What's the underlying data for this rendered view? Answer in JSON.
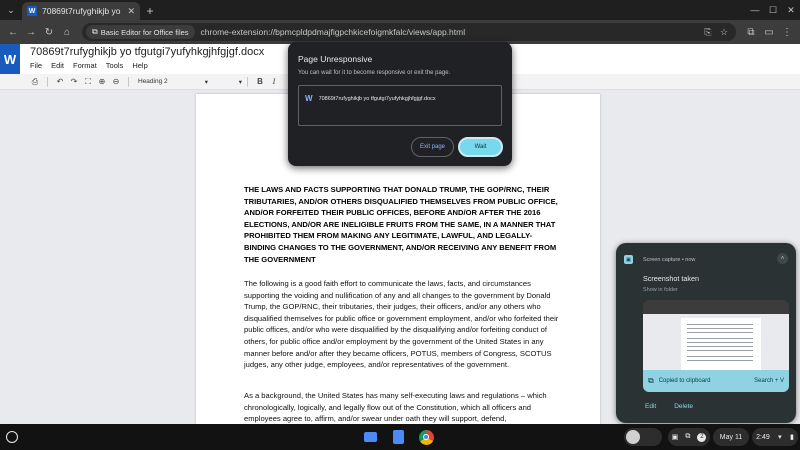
{
  "browser": {
    "tab_title": "70869t7rufyghikjb yo tfgutgi7yufyhkgjhfgjgf.docx",
    "tab_favicon": "W",
    "extension_chip": "Basic Editor for Office files",
    "url": "chrome-extension://bpmcpldpdmajfigpchkicefoigmkfalc/views/app.html"
  },
  "app": {
    "logo": "W",
    "doc_title": "70869t7rufyghikjb yo tfgutgi7yufyhkgjhfgjgf.docx",
    "menu": [
      "File",
      "Edit",
      "Format",
      "Tools",
      "Help"
    ],
    "style_select": "Heading 2",
    "bold": "B",
    "italic": "I"
  },
  "document": {
    "heading": "THE LAWS AND FACTS SUPPORTING THAT DONALD TRUMP, THE GOP/RNC, THEIR TRIBUTARIES, AND/OR OTHERS DISQUALIFIED THEMSELVES FROM PUBLIC OFFICE, AND/OR FORFEITED THEIR PUBLIC OFFICES, BEFORE AND/OR AFTER THE 2016 ELECTIONS, AND/OR ARE INELIGIBLE FRUITS FROM THE SAME, IN A MANNER THAT PROHIBITED THEM FROM MAKING ANY LEGITIMATE, LAWFUL, AND LEGALLY-BINDING CHANGES TO THE GOVERNMENT, AND/OR RECEIVING ANY BENEFIT FROM THE GOVERNMENT",
    "paragraph1": "The following is a good faith effort to communicate the laws, facts, and circumstances supporting the voiding and nullification of any and all changes to the government by Donald Trump, the GOP/RNC, their tributaries, their judges, their officers, and/or any others who disqualified themselves for public office or government employment, and/or who forfeited their public offices, and/or who were disqualified by the disqualifying and/or forfeiting conduct of others, for public office and/or employment by the government of the United States in any manner before and/or after they became officers, POTUS, members of Congress, SCOTUS judges, any other judge, employees, and/or representatives of the government.",
    "paragraph2": "As a background, the United States has many self-executing laws and regulations – which chronologically, logically, and legally flow out of the Constitution, which all officers and employees agree to, affirm, and/or swear under oath they will support, defend,"
  },
  "dialog": {
    "title": "Page Unresponsive",
    "message": "You can wait for it to become responsive or exit the page.",
    "item": "70869t7rufyghikjb yo tfgutgi7yufyhkgjhfgjgf.docx",
    "exit_label": "Exit page",
    "wait_label": "Wait"
  },
  "notification": {
    "source": "Screen capture • now",
    "title": "Screenshot taken",
    "subtitle": "Show in folder",
    "clipboard": "Copied to clipboard",
    "search_hint": "Search + V",
    "edit_label": "Edit",
    "delete_label": "Delete"
  },
  "shelf": {
    "notification_count": "2",
    "date": "May 11",
    "time": "2:49"
  },
  "colors": {
    "word_blue": "#185abd",
    "accent_cyan": "#78d9ec",
    "dialog_bg": "#202124"
  }
}
